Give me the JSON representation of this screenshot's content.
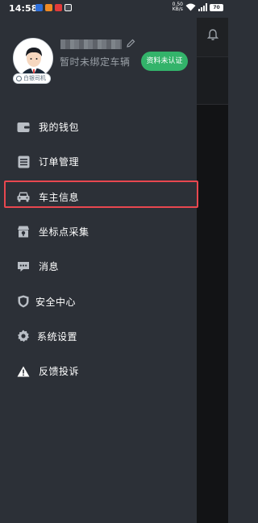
{
  "status_bar": {
    "time": "14:58",
    "apps": [
      {
        "icon": "app-icon-blue",
        "color": "#2e6fd9"
      },
      {
        "icon": "app-icon-orange",
        "color": "#f08a24"
      },
      {
        "icon": "app-icon-red",
        "color": "#e23b3b"
      },
      {
        "icon": "app-icon-dark",
        "color": "#444a52"
      }
    ],
    "net_speed_value": "0.50",
    "net_speed_unit": "KB/s",
    "battery": "70"
  },
  "profile": {
    "username": "",
    "driver_badge": "白银司机",
    "vehicle_status": "暂时未绑定车辆",
    "verify_button": "资料未认证"
  },
  "menu": {
    "items": [
      {
        "label": "我的钱包",
        "icon": "wallet-icon"
      },
      {
        "label": "订单管理",
        "icon": "order-list-icon"
      },
      {
        "label": "车主信息",
        "icon": "car-icon",
        "selected": true
      },
      {
        "label": "坐标点采集",
        "icon": "store-location-icon"
      },
      {
        "label": "消息",
        "icon": "message-icon"
      },
      {
        "label": "安全中心",
        "icon": "shield-icon"
      },
      {
        "label": "系统设置",
        "icon": "gear-icon"
      },
      {
        "label": "反馈投诉",
        "icon": "warning-icon"
      }
    ]
  },
  "colors": {
    "drawer_bg": "#2c3037",
    "accent_green": "#33b36a",
    "highlight_red": "#e8474f",
    "icon_gray": "#b9bec5"
  }
}
